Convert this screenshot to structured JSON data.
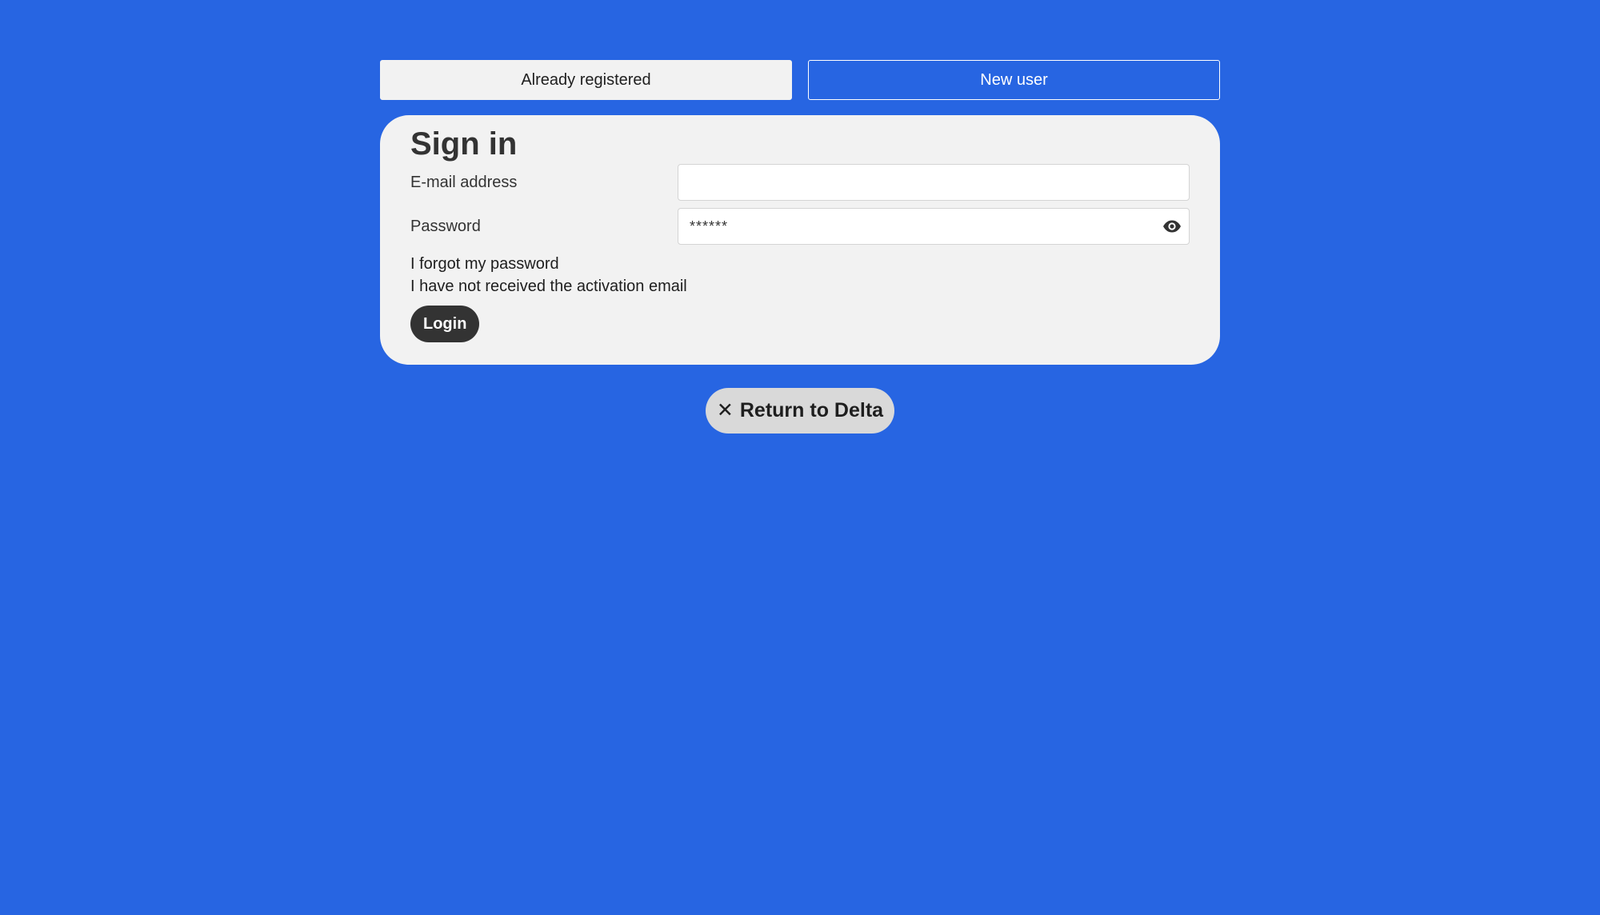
{
  "tabs": {
    "already_registered": "Already registered",
    "new_user": "New user"
  },
  "signin": {
    "title": "Sign in",
    "email_label": "E-mail address",
    "email_value": "",
    "password_label": "Password",
    "password_value": "******",
    "password_toggle_icon": "eye-icon",
    "forgot_password": "I forgot my password",
    "no_activation_email": "I have not received the activation email",
    "login_button": "Login"
  },
  "return_button": {
    "icon": "✕",
    "label": "Return to Delta"
  },
  "colors": {
    "background": "#2765e2",
    "card": "#f2f2f2",
    "dark_button": "#333333",
    "return_button": "#d9d9d9"
  }
}
